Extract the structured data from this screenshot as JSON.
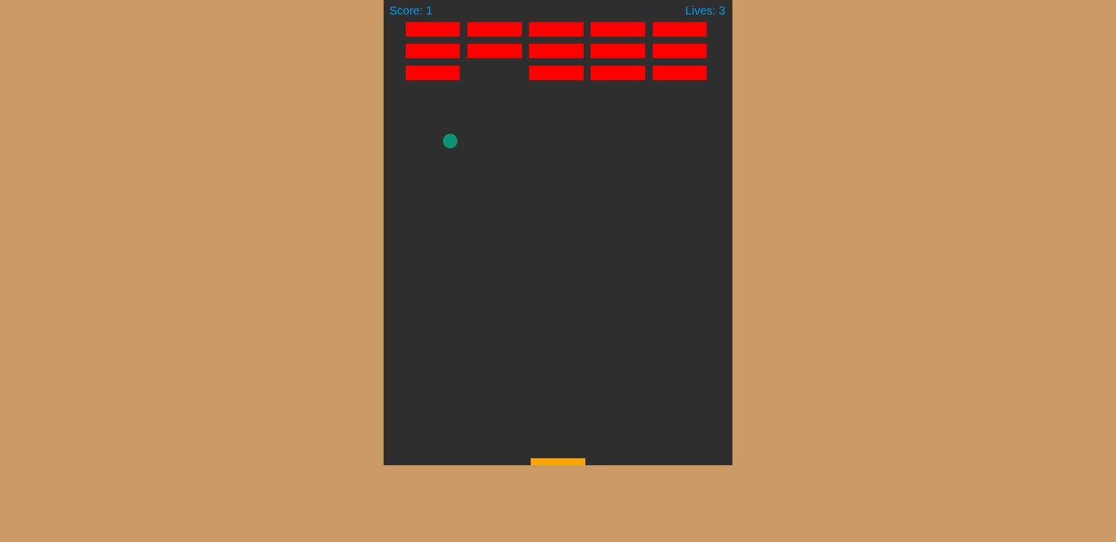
{
  "hud": {
    "score": "Score: 1",
    "lives": "Lives: 3"
  },
  "bricks": [
    [
      {
        "broken": false
      },
      {
        "broken": false
      },
      {
        "broken": false
      },
      {
        "broken": false
      },
      {
        "broken": false
      }
    ],
    [
      {
        "broken": false
      },
      {
        "broken": false
      },
      {
        "broken": false
      },
      {
        "broken": false
      },
      {
        "broken": false
      }
    ],
    [
      {
        "broken": false
      },
      {
        "broken": true
      },
      {
        "broken": false
      },
      {
        "broken": false
      },
      {
        "broken": false
      }
    ]
  ]
}
